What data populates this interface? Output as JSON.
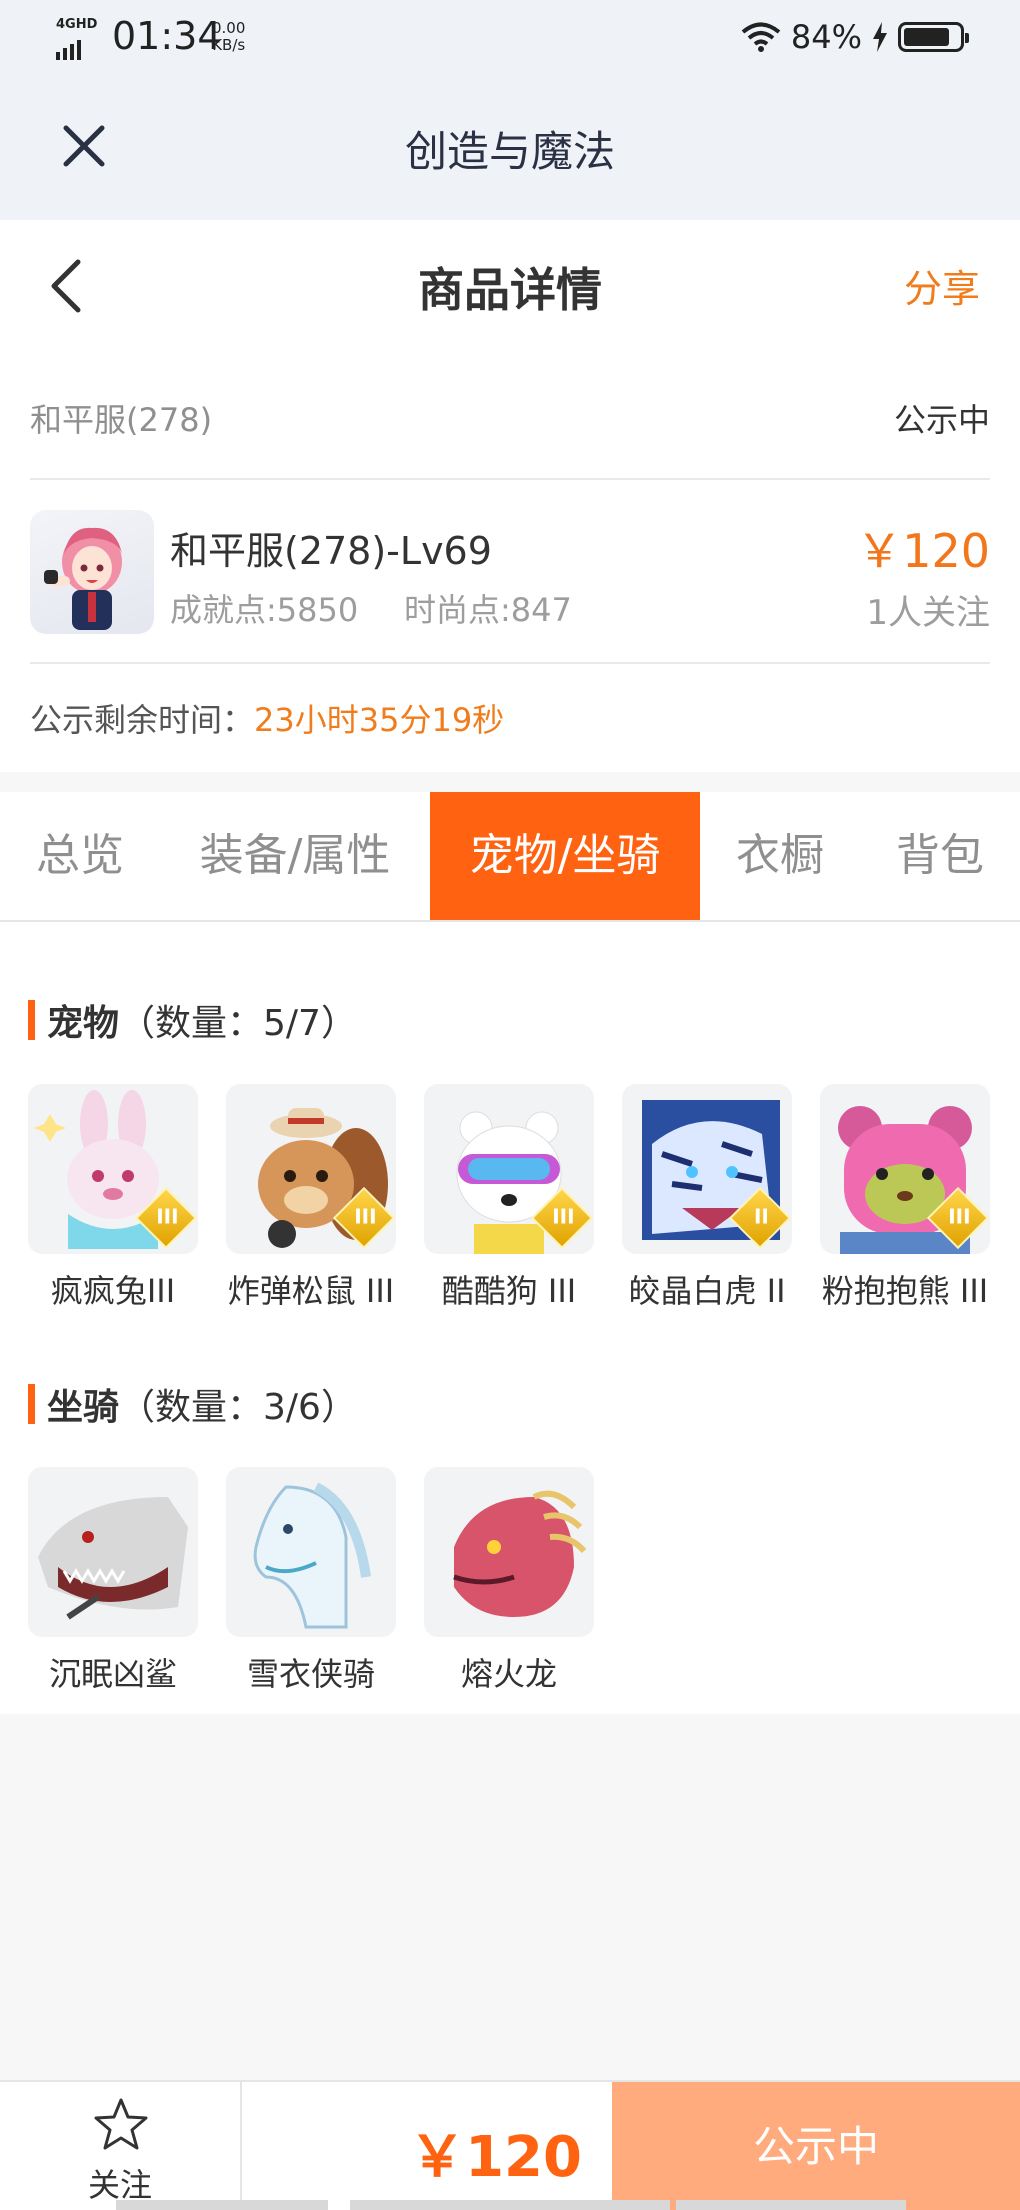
{
  "status_bar": {
    "network": "4GHD",
    "time": "01:34",
    "speed_value": "0.00",
    "speed_unit": "KB/s",
    "battery": "84%",
    "battery_level": 0.84
  },
  "app_bar": {
    "title": "创造与魔法"
  },
  "header": {
    "title": "商品详情",
    "share_label": "分享"
  },
  "listing": {
    "server": "和平服(278)",
    "status": "公示中",
    "character_name": "和平服(278)-Lv69",
    "achievement": "成就点:5850",
    "fashion": "时尚点:847",
    "price": "￥120",
    "followers": "1人关注",
    "remaining_label": "公示剩余时间：",
    "remaining_value": "23小时35分19秒"
  },
  "tabs": [
    {
      "label": "总览",
      "active": false
    },
    {
      "label": "装备/属性",
      "active": false
    },
    {
      "label": "宠物/坐骑",
      "active": true
    },
    {
      "label": "衣橱",
      "active": false
    },
    {
      "label": "背包",
      "active": false
    }
  ],
  "pets": {
    "title": "宠物",
    "count": "（数量：5/7）",
    "items": [
      {
        "name": "疯疯兔III",
        "rank": "III",
        "icon": "rabbit-icon"
      },
      {
        "name": "炸弹松鼠 III",
        "rank": "III",
        "icon": "squirrel-icon"
      },
      {
        "name": "酷酷狗 III",
        "rank": "III",
        "icon": "bear-dog-icon"
      },
      {
        "name": "皎晶白虎 II",
        "rank": "II",
        "icon": "tiger-icon"
      },
      {
        "name": "粉抱抱熊 III",
        "rank": "III",
        "icon": "pink-bear-icon"
      }
    ]
  },
  "mounts": {
    "title": "坐骑",
    "count": "（数量：3/6）",
    "items": [
      {
        "name": "沉眠凶鲨",
        "icon": "shark-icon"
      },
      {
        "name": "雪衣侠骑",
        "icon": "horse-icon"
      },
      {
        "name": "熔火龙",
        "icon": "dragon-icon"
      }
    ]
  },
  "bottom_bar": {
    "follow_label": "关注",
    "price": "￥120",
    "status": "公示中"
  },
  "colors": {
    "accent": "#ff6312",
    "accent_text": "#f07c1c",
    "disabled_button": "#ffab7d"
  }
}
